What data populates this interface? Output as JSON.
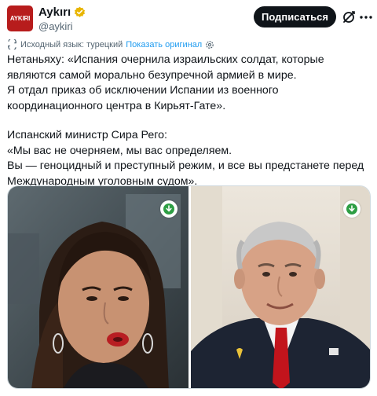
{
  "header": {
    "avatar_text": "AYKIRI",
    "display_name": "Aykırı",
    "handle": "@aykiri",
    "subscribe_label": "Подписаться"
  },
  "translation": {
    "source_language": "Исходный язык: турецкий",
    "show_original": "Показать оригинал"
  },
  "tweet": {
    "lines": [
      "Нетаньяху: «Испания очернила израильских солдат, которые",
      "являются самой морально безупречной армией в мире.",
      "Я отдал приказ об исключении Испании из военного",
      "координационного центра в Кирьят-Гате».",
      "Испанский министр Сира Рего:",
      "«Мы вас не очерняем, мы вас определяем.",
      "Вы — геноцидный и преступный режим, и все вы предстанете перед",
      "Международным уголовным судом»."
    ]
  },
  "media": {
    "photos": [
      {
        "subject": "woman-portrait",
        "download_icon": "download-icon"
      },
      {
        "subject": "man-portrait",
        "download_icon": "download-icon"
      }
    ]
  },
  "colors": {
    "accent": "#1d9bf0",
    "verified": "#e8b500",
    "button_bg": "#0f1419",
    "download_green": "#2e9e44"
  }
}
